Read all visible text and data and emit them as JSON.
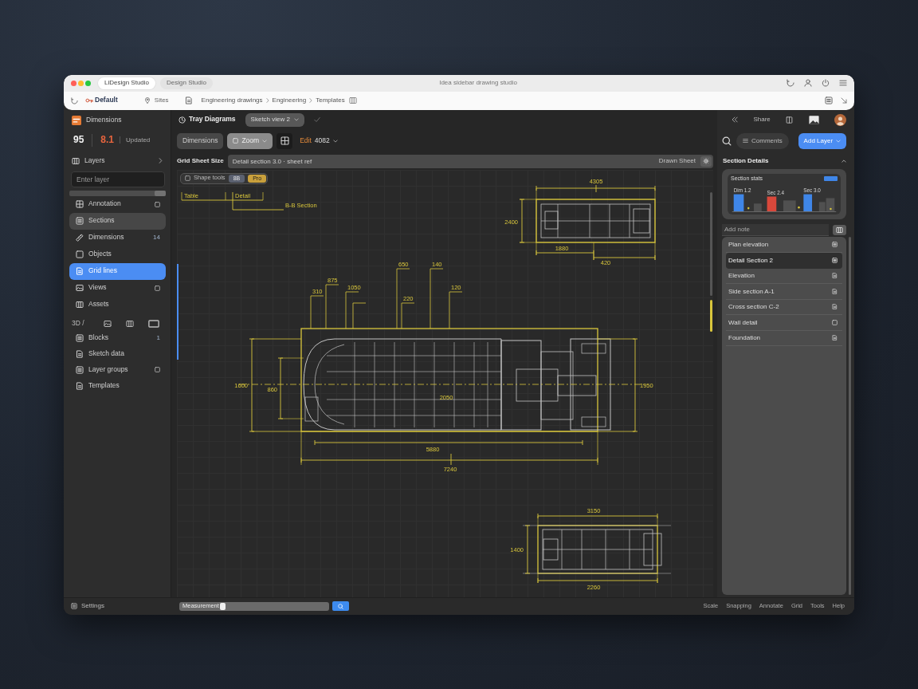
{
  "browser": {
    "tabs": [
      {
        "label": "LiDesign Studio",
        "selected": true
      },
      {
        "label": "Design Studio",
        "selected": false
      }
    ],
    "page_title": "Idea sidebar drawing studio",
    "profile": "Default",
    "location": "Sites",
    "breadcrumbs": [
      "Engineering drawings",
      "Engineering",
      "Templates"
    ]
  },
  "sidebar": {
    "app_name": "Dimensions",
    "stats": [
      {
        "value": "95",
        "kind": "count"
      },
      {
        "value": "8.1",
        "kind": "alert"
      }
    ],
    "stats_caption": "Updated",
    "section_title": "Layers",
    "search": {
      "placeholder": "Enter layer"
    },
    "items": [
      {
        "label": "Annotation",
        "selected": false,
        "hovered": false,
        "action": true
      },
      {
        "label": "Sections",
        "selected": false,
        "hovered": true
      },
      {
        "label": "Dimensions",
        "selected": false,
        "hovered": false,
        "badge": "14"
      },
      {
        "label": "Objects",
        "selected": false,
        "hovered": false
      },
      {
        "label": "Grid lines",
        "selected": true,
        "hovered": false
      },
      {
        "label": "Views",
        "selected": false,
        "hovered": false,
        "action": true
      },
      {
        "label": "Assets",
        "selected": false,
        "hovered": false
      }
    ],
    "tools_label": "3D /",
    "groups": [
      {
        "label": "Blocks",
        "selected": false,
        "hovered": false,
        "badge": "1"
      },
      {
        "label": "Sketch data",
        "selected": false,
        "hovered": false
      },
      {
        "label": "Layer groups",
        "selected": false,
        "hovered": false,
        "action": true
      },
      {
        "label": "Templates",
        "selected": false,
        "hovered": false
      }
    ]
  },
  "document": {
    "title": "Tray Diagrams",
    "view": "Sketch view 2"
  },
  "toolbar": {
    "buttons": [
      {
        "label": "Dimensions",
        "selected": false
      },
      {
        "label": "Zoom",
        "selected": true
      }
    ],
    "edit_label": "Edit",
    "edit_value": "4082"
  },
  "sheet": {
    "label": "Grid Sheet Size",
    "value": "Detail section 3.0 · sheet ref",
    "status": "Drawn Sheet"
  },
  "shape_tools": {
    "label": "Shape tools",
    "tags": [
      {
        "text": "8B",
        "color": "#5b6170"
      },
      {
        "text": "Pro",
        "color": "#c9a03c"
      }
    ]
  },
  "drawing": {
    "notes": [
      "Table",
      "Detail",
      "B-B Section"
    ],
    "top_view": [
      "4305",
      "2400",
      "1880",
      "420"
    ],
    "front_view": [
      "650",
      "875",
      "310",
      "1050",
      "220",
      "140",
      "120",
      "1600",
      "860",
      "1950",
      "2050",
      "5880",
      "7240"
    ],
    "bottom_view": [
      "3150",
      "1400",
      "2260"
    ]
  },
  "right_panel": {
    "share_label": "Share",
    "comments_label": "Comments",
    "add_button": "Add Layer",
    "section_title": "Section Details",
    "chart": {
      "title": "Section stats",
      "bars": [
        {
          "label": "Dim 1.2",
          "color": "#3f86e8"
        },
        {
          "label": "Sec 2.4",
          "color": "#d9483b"
        },
        {
          "label": "Sec 3.0",
          "color": "#3f86e8"
        }
      ]
    },
    "note": {
      "placeholder": "Add note"
    },
    "list": [
      {
        "label": "Plan elevation",
        "selected": false
      },
      {
        "label": "Detail Section 2",
        "selected": true
      },
      {
        "label": "Elevation",
        "selected": false
      },
      {
        "label": "Side section A-1",
        "selected": false
      },
      {
        "label": "Cross section C-2",
        "selected": false
      },
      {
        "label": "Wall detail",
        "selected": false
      },
      {
        "label": "Foundation",
        "selected": false
      }
    ]
  },
  "footer": {
    "settings_label": "Settings",
    "measure": {
      "label": "Measurement",
      "level": 0.27
    },
    "status": [
      "Scale",
      "Snapping",
      "Annotate",
      "Grid",
      "Tools",
      "Help"
    ]
  }
}
